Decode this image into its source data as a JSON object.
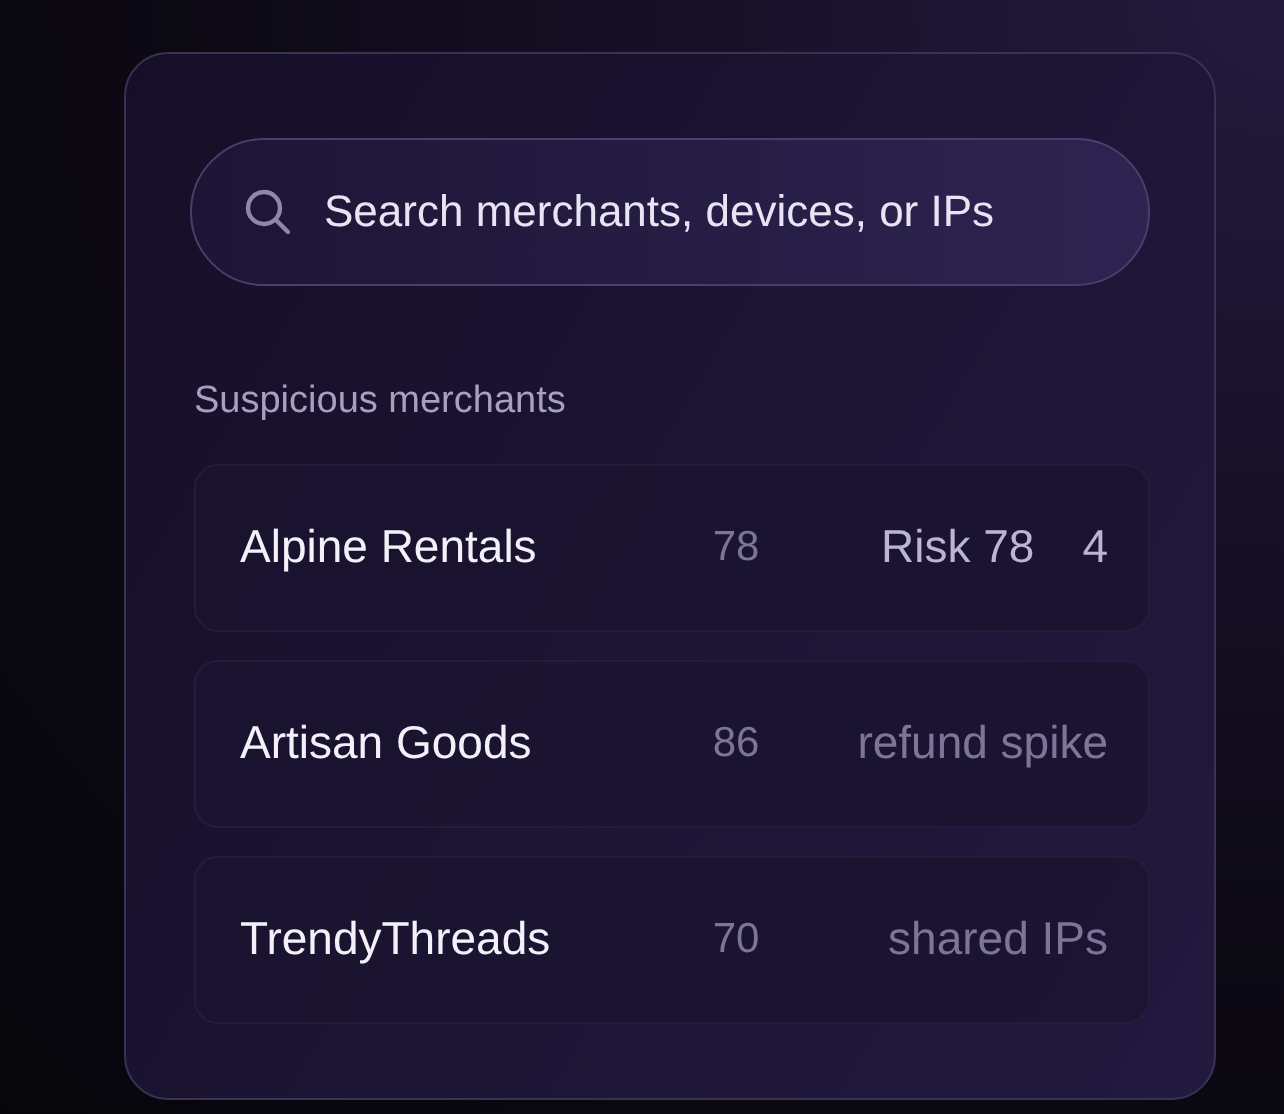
{
  "search": {
    "placeholder": "Search merchants, devices, or IPs"
  },
  "section_title": "Suspicious merchants",
  "merchants": [
    {
      "name": "Alpine Rentals",
      "score": "78",
      "note": "Risk 78",
      "count": "4"
    },
    {
      "name": "Artisan Goods",
      "score": "86",
      "note": "refund spike"
    },
    {
      "name": "TrendyThreads",
      "score": "70",
      "note": "shared IPs"
    }
  ]
}
